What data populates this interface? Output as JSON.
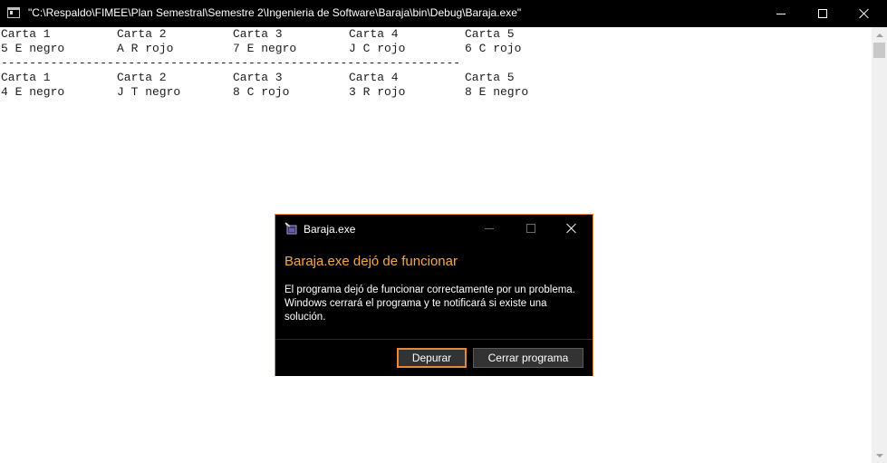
{
  "window": {
    "title": "\"C:\\Respaldo\\FIMEE\\Plan Semestral\\Semestre 2\\Ingenieria de Software\\Baraja\\bin\\Debug\\Baraja.exe\""
  },
  "console": {
    "round1": {
      "headers": [
        "Carta 1",
        "Carta 2",
        "Carta 3",
        "Carta 4",
        "Carta 5"
      ],
      "cards": [
        "5 E negro",
        "A R rojo",
        "7 E negro",
        "J C rojo",
        "6 C rojo"
      ]
    },
    "separator": "-----------------------------------------------------------------",
    "round2": {
      "headers": [
        "Carta 1",
        "Carta 2",
        "Carta 3",
        "Carta 4",
        "Carta 5"
      ],
      "cards": [
        "4 E negro",
        "J T negro",
        "8 C rojo",
        "3 R rojo",
        "8 E negro"
      ]
    }
  },
  "dialog": {
    "title": "Baraja.exe",
    "heading": "Baraja.exe dejó de funcionar",
    "message": "El programa dejó de funcionar correctamente por un problema. Windows cerrará el programa y te notificará si existe una solución.",
    "primary_button": "Depurar",
    "secondary_button": "Cerrar programa",
    "accent_color": "#e8883a",
    "heading_color": "#f0a84a"
  },
  "icons": {
    "app": "console-app-icon",
    "dialog": "app-exe-icon"
  }
}
